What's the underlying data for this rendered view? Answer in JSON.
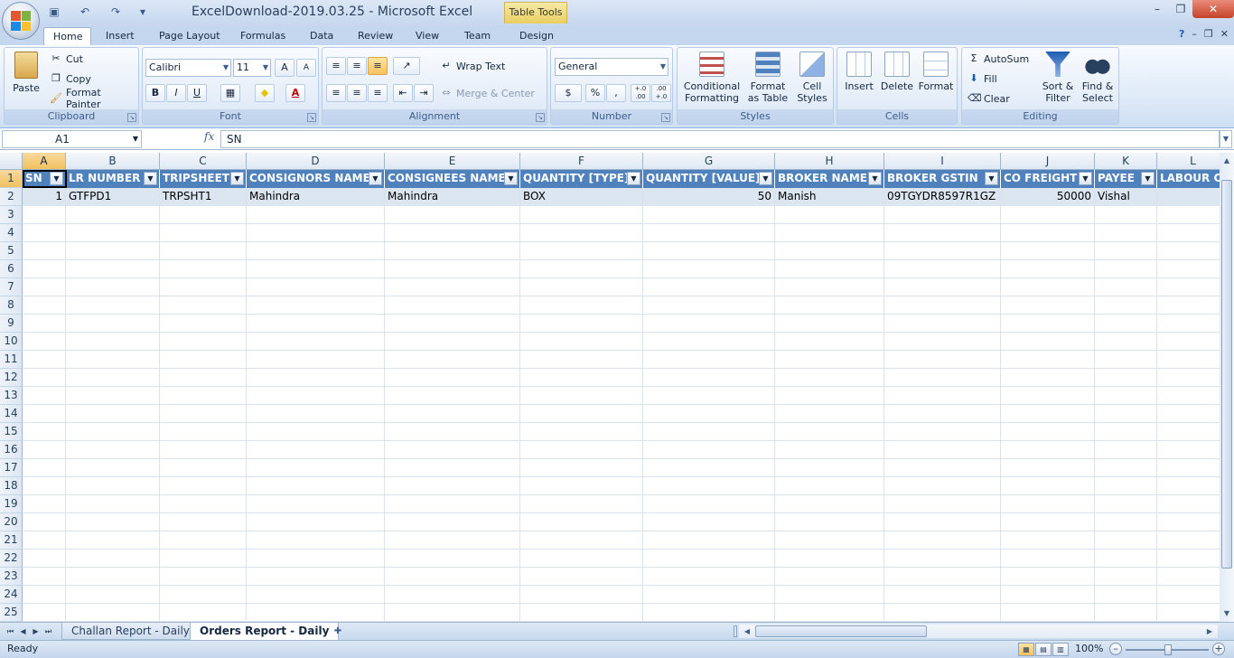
{
  "window": {
    "title": "ExcelDownload-2019.03.25 - Microsoft Excel",
    "context_tab": "Table Tools"
  },
  "ribbon_tabs": [
    "Home",
    "Insert",
    "Page Layout",
    "Formulas",
    "Data",
    "Review",
    "View",
    "Team",
    "Design"
  ],
  "ribbon": {
    "clipboard": {
      "paste": "Paste",
      "cut": "Cut",
      "copy": "Copy",
      "format_painter": "Format Painter",
      "label": "Clipboard"
    },
    "font": {
      "family": "Calibri",
      "size": "11",
      "bold": "B",
      "italic": "I",
      "underline": "U",
      "grow": "A",
      "shrink": "A",
      "font_color": "A",
      "label": "Font"
    },
    "alignment": {
      "wrap_text": "Wrap Text",
      "merge_center": "Merge & Center",
      "label": "Alignment"
    },
    "number": {
      "format": "General",
      "percent": "%",
      "comma": ",",
      "inc_decimal": "+.0 .00",
      "dec_decimal": ".00 +.0",
      "label": "Number"
    },
    "styles": {
      "conditional_1": "Conditional",
      "conditional_2": "Formatting",
      "format_table_1": "Format",
      "format_table_2": "as Table",
      "cell_styles_1": "Cell",
      "cell_styles_2": "Styles",
      "label": "Styles"
    },
    "cells": {
      "insert": "Insert",
      "delete": "Delete",
      "format": "Format",
      "label": "Cells"
    },
    "editing": {
      "autosum": "AutoSum",
      "fill": "Fill",
      "clear": "Clear",
      "sort_1": "Sort &",
      "sort_2": "Filter",
      "find_1": "Find &",
      "find_2": "Select",
      "label": "Editing"
    }
  },
  "formula_bar": {
    "name_box": "A1",
    "fx": "fx",
    "value": "SN"
  },
  "sheet": {
    "columns": [
      "A",
      "B",
      "C",
      "D",
      "E",
      "F",
      "G",
      "H",
      "I",
      "J",
      "K",
      "L"
    ],
    "rows": [
      "1",
      "2",
      "3",
      "4",
      "5",
      "6",
      "7",
      "8",
      "9",
      "10",
      "11",
      "12",
      "13",
      "14",
      "15",
      "16",
      "17",
      "18",
      "19",
      "20",
      "21",
      "22",
      "23",
      "24",
      "25"
    ],
    "headers": [
      "SN",
      "LR NUMBER",
      "TRIPSHEET",
      "CONSIGNORS NAME",
      "CONSIGNEES NAME",
      "QUANTITY [TYPE]",
      "QUANTITY [VALUE]",
      "BROKER NAME",
      "BROKER GSTIN",
      "CO FREIGHT",
      "PAYEE",
      "LABOUR CH"
    ],
    "data_row": [
      "1",
      "GTFPD1",
      "TRPSHT1",
      "Mahindra",
      "Mahindra",
      "BOX",
      "50",
      "Manish",
      "09TGYDR8597R1GZ",
      "50000",
      "Vishal",
      ""
    ]
  },
  "sheet_tabs": [
    "Challan Report - Daily",
    "Orders Report - Daily"
  ],
  "status": {
    "text": "Ready",
    "zoom": "100%"
  },
  "colors": {
    "table_header": "#4f81bd",
    "table_row": "#dce6f1",
    "accent": "#c7432a"
  }
}
